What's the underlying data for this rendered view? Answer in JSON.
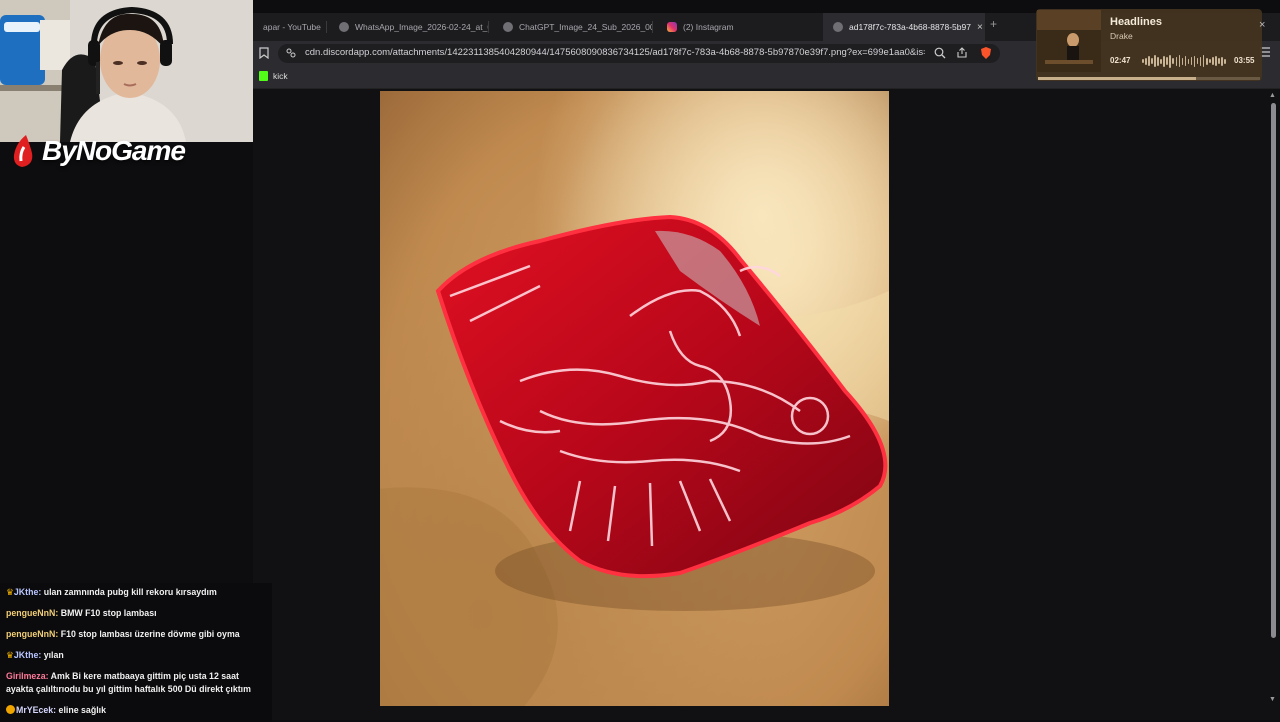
{
  "browser": {
    "tabs": [
      {
        "label": "apar - YouTube",
        "icon": "youtube-icon",
        "active": false
      },
      {
        "label": "WhatsApp_Image_2026-02-24_at_00",
        "icon": "globe-icon",
        "active": false
      },
      {
        "label": "ChatGPT_Image_24_Sub_2026_00_13",
        "icon": "globe-icon",
        "active": false
      },
      {
        "label": "(2) Instagram",
        "icon": "instagram-icon",
        "active": false
      },
      {
        "label": "ad178f7c-783a-4b68-8878-5b97",
        "icon": "globe-icon",
        "active": true
      }
    ],
    "new_tab": "+",
    "close_tab": "×",
    "url": "cdn.discordapp.com/attachments/1422311385404280944/1475608090836734125/ad178f7c-783a-4b68-8878-5b97870e39f7.png?ex=699e1aa0&is=...",
    "bookmark": "kick",
    "accent": "#53fc18"
  },
  "stream": {
    "logo_text": "ByNoGame"
  },
  "music": {
    "title": "Headlines",
    "artist": "Drake",
    "elapsed": "02:47",
    "duration": "03:55",
    "progress": 0.71
  },
  "chat": {
    "messages": [
      {
        "user": "JKthe",
        "badge": "crown",
        "text": "ulan zamnında pubg kill rekoru kırsaydım",
        "color": "#b8c6ff"
      },
      {
        "user": "pengueNnN",
        "badge": "",
        "text": "BMW F10 stop lambası",
        "color": "#f2cf76"
      },
      {
        "user": "pengueNnN",
        "badge": "",
        "text": "F10 stop lambası üzerine dövme gibi oyma",
        "color": "#f2cf76"
      },
      {
        "user": "JKthe",
        "badge": "crown",
        "text": "yılan",
        "color": "#b8c6ff"
      },
      {
        "user": "Girilmeza",
        "badge": "",
        "text": "Amk Bi kere matbaaya gittim piç usta 12 saat ayakta çalıltırıodu bu yıl gittim haftalık 500 Dü direkt çıktım",
        "color": "#ff7a9a"
      },
      {
        "user": "MrYEcek",
        "badge": "coin",
        "text": "eline sağlık",
        "color": "#d7d7ff"
      }
    ]
  }
}
